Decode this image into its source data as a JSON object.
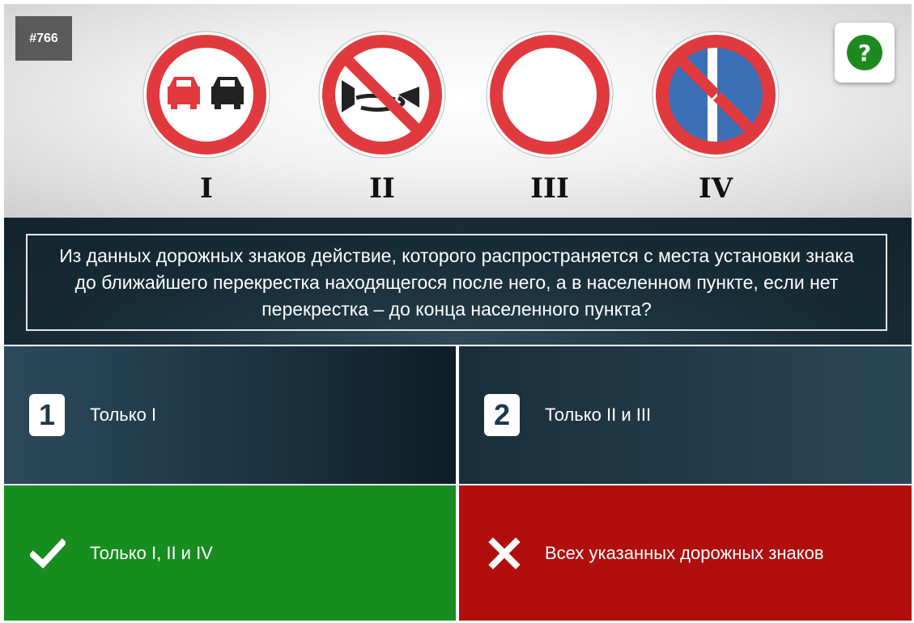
{
  "question": {
    "number": "#766",
    "text": "Из данных дорожных знаков действие, которого распространяется с места установки знака до ближайшего перекрестка находящегося после него, а в населенном пункте, если нет перекрестка – до конца населенного пункта?"
  },
  "help": {
    "icon": "question-circle-icon",
    "color": "#1e8a1e"
  },
  "signs": [
    {
      "label": "I",
      "icon": "no-overtaking-sign"
    },
    {
      "label": "II",
      "icon": "no-horn-sign"
    },
    {
      "label": "III",
      "icon": "no-traffic-sign"
    },
    {
      "label": "IV",
      "icon": "no-parking-even-days-sign"
    }
  ],
  "answers": [
    {
      "marker": "1",
      "text": "Только I",
      "state": "neutral"
    },
    {
      "marker": "2",
      "text": "Только II и III",
      "state": "neutral"
    },
    {
      "marker": "check-icon",
      "text": "Только I, II и IV",
      "state": "correct"
    },
    {
      "marker": "cross-icon",
      "text": "Всех указанных дорожных знаков",
      "state": "wrong"
    }
  ],
  "colors": {
    "correct": "#178c1f",
    "wrong": "#b10e0e",
    "sign_red": "#e03a3e",
    "sign_blue": "#3d6fb6"
  }
}
